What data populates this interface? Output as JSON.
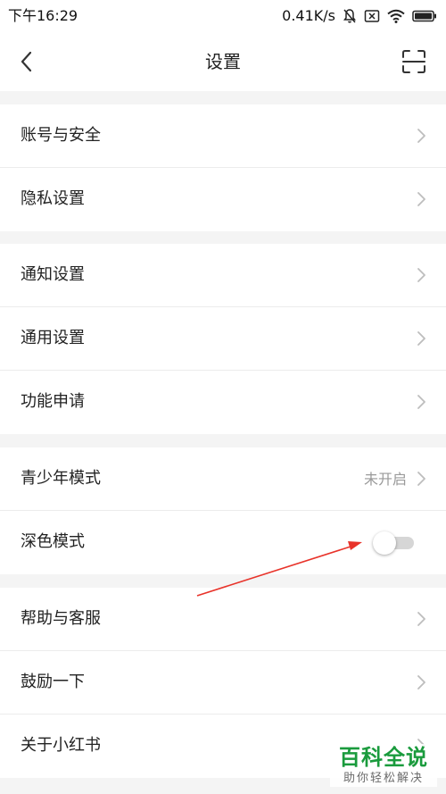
{
  "status_bar": {
    "time": "下午16:29",
    "network_speed": "0.41K/s",
    "icons": [
      "bell-muted-icon",
      "sim-off-icon",
      "wifi-icon",
      "battery-icon"
    ]
  },
  "nav": {
    "title": "设置",
    "back_icon": "chevron-left-icon",
    "scan_icon": "scan-icon"
  },
  "sections": [
    {
      "items": [
        {
          "label": "账号与安全"
        },
        {
          "label": "隐私设置"
        }
      ]
    },
    {
      "items": [
        {
          "label": "通知设置"
        },
        {
          "label": "通用设置"
        },
        {
          "label": "功能申请"
        }
      ]
    },
    {
      "items": [
        {
          "label": "青少年模式",
          "value": "未开启"
        },
        {
          "label": "深色模式",
          "toggle_on": false
        }
      ]
    },
    {
      "items": [
        {
          "label": "帮助与客服"
        },
        {
          "label": "鼓励一下"
        },
        {
          "label": "关于小红书"
        }
      ]
    }
  ],
  "annotation": {
    "color": "#e8332a"
  },
  "watermark": {
    "title": "百科全说",
    "subtitle": "助你轻松解决",
    "color": "#1a9b3d"
  }
}
